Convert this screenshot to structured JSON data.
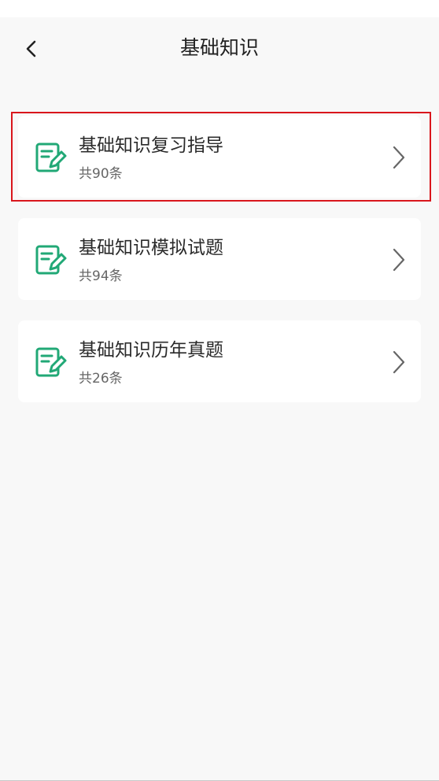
{
  "header": {
    "title": "基础知识"
  },
  "items": [
    {
      "title": "基础知识复习指导",
      "count": "共90条",
      "highlighted": true
    },
    {
      "title": "基础知识模拟试题",
      "count": "共94条",
      "highlighted": false
    },
    {
      "title": "基础知识历年真题",
      "count": "共26条",
      "highlighted": false
    }
  ],
  "colors": {
    "accent": "#21a876",
    "highlight_border": "#d9161c",
    "background": "#f8f8f8"
  },
  "icons": {
    "back": "chevron-left-icon",
    "item": "note-pencil-icon",
    "arrow": "chevron-right-icon"
  }
}
